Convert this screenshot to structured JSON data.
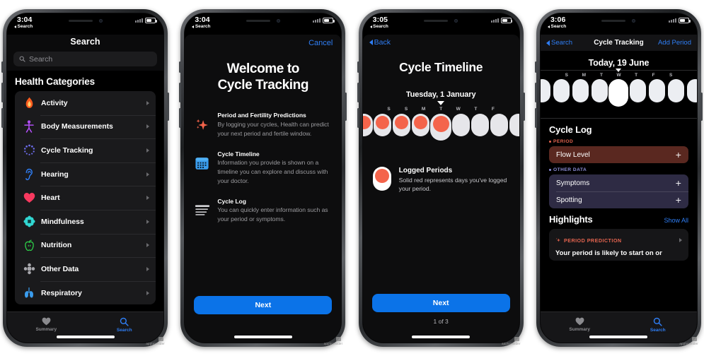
{
  "phones": [
    {
      "id": "phone-search",
      "status": {
        "time": "3:04",
        "back_label": "Search",
        "battery_icon": "battery-icon",
        "signal_icon": "signal-icon"
      },
      "screen": {
        "title": "Search",
        "search": {
          "placeholder": "Search",
          "value": "",
          "icon": "search-icon"
        },
        "section_label": "Health Categories",
        "categories": [
          {
            "label": "Activity",
            "icon": "flame-icon",
            "color": "#fb5b1e"
          },
          {
            "label": "Body Measurements",
            "icon": "body-icon",
            "color": "#b14ef5"
          },
          {
            "label": "Cycle Tracking",
            "icon": "cycle-icon",
            "color": "#6e6ef0"
          },
          {
            "label": "Hearing",
            "icon": "ear-icon",
            "color": "#2f7ef5"
          },
          {
            "label": "Heart",
            "icon": "heart-icon",
            "color": "#f8395f"
          },
          {
            "label": "Mindfulness",
            "icon": "mindfulness-icon",
            "color": "#31d7d2"
          },
          {
            "label": "Nutrition",
            "icon": "apple-icon",
            "color": "#2ed44a"
          },
          {
            "label": "Other Data",
            "icon": "other-data-icon",
            "color": "#a8a8ad"
          },
          {
            "label": "Respiratory",
            "icon": "lungs-icon",
            "color": "#3a9ced"
          }
        ],
        "tabs": [
          {
            "label": "Summary",
            "icon": "heart-filled-icon",
            "active": false
          },
          {
            "label": "Search",
            "icon": "search-icon",
            "active": true
          }
        ]
      }
    },
    {
      "id": "phone-welcome",
      "status": {
        "time": "3:04",
        "back_label": "Search"
      },
      "screen": {
        "cancel_label": "Cancel",
        "title_line1": "Welcome to",
        "title_line2": "Cycle Tracking",
        "features": [
          {
            "icon": "sparkle-icon",
            "heading": "Period and Fertility Predictions",
            "body": "By logging your cycles, Health can predict your next period and fertile window."
          },
          {
            "icon": "calendar-icon",
            "heading": "Cycle Timeline",
            "body": "Information you provide is shown on a timeline you can explore and discuss with your doctor."
          },
          {
            "icon": "list-lines-icon",
            "heading": "Cycle Log",
            "body": "You can quickly enter information such as your period or symptoms."
          }
        ],
        "next_label": "Next"
      }
    },
    {
      "id": "phone-timeline",
      "status": {
        "time": "3:05",
        "back_label": "Search"
      },
      "screen": {
        "back_label": "Back",
        "title": "Cycle Timeline",
        "date": "Tuesday, 1 January",
        "day_letters": [
          "S",
          "S",
          "M",
          "T",
          "W",
          "T",
          "F"
        ],
        "days": [
          {
            "letter": "",
            "logged": true,
            "selected": false,
            "partial": true
          },
          {
            "letter": "S",
            "logged": true,
            "selected": false
          },
          {
            "letter": "S",
            "logged": true,
            "selected": false
          },
          {
            "letter": "M",
            "logged": true,
            "selected": false
          },
          {
            "letter": "T",
            "logged": true,
            "selected": true
          },
          {
            "letter": "W",
            "logged": false,
            "selected": false
          },
          {
            "letter": "T",
            "logged": false,
            "selected": false
          },
          {
            "letter": "F",
            "logged": false,
            "selected": false
          },
          {
            "letter": "",
            "logged": false,
            "selected": false,
            "partial": true
          }
        ],
        "legend": {
          "heading": "Logged Periods",
          "body": "Solid red represents days you've logged your period."
        },
        "next_label": "Next",
        "page_indicator": "1 of 3"
      }
    },
    {
      "id": "phone-cycle-tracking",
      "status": {
        "time": "3:06",
        "back_label": "Search"
      },
      "screen": {
        "nav": {
          "back_label": "Search",
          "title": "Cycle Tracking",
          "action_label": "Add Period"
        },
        "today_label": "Today, 19 June",
        "day_letters": [
          "S",
          "M",
          "T",
          "W",
          "T",
          "F",
          "S"
        ],
        "days": [
          {
            "letter": "",
            "selected": false,
            "partial": true
          },
          {
            "letter": "S",
            "selected": false
          },
          {
            "letter": "M",
            "selected": false
          },
          {
            "letter": "T",
            "selected": false
          },
          {
            "letter": "W",
            "selected": true
          },
          {
            "letter": "T",
            "selected": false
          },
          {
            "letter": "F",
            "selected": false
          },
          {
            "letter": "S",
            "selected": false
          },
          {
            "letter": "",
            "selected": false,
            "partial": true
          }
        ],
        "cycle_log": {
          "heading": "Cycle Log",
          "groups": [
            {
              "label": "PERIOD",
              "color": "#e4644f",
              "card_bg": "#5a2820",
              "items": [
                {
                  "label": "Flow Level",
                  "action": "+"
                }
              ]
            },
            {
              "label": "OTHER DATA",
              "color": "#8e8ed8",
              "card_bg": "#2e2b44",
              "items": [
                {
                  "label": "Symptoms",
                  "action": "+"
                },
                {
                  "label": "Spotting",
                  "action": "+"
                }
              ]
            }
          ]
        },
        "highlights": {
          "heading": "Highlights",
          "show_all_label": "Show All",
          "card": {
            "tag": "PERIOD PREDICTION",
            "tag_icon": "sparkle-icon",
            "body": "Your period is likely to start on or"
          }
        },
        "tabs": [
          {
            "label": "Summary",
            "icon": "heart-filled-icon",
            "active": false
          },
          {
            "label": "Search",
            "icon": "search-icon",
            "active": true
          }
        ]
      }
    }
  ],
  "watermark": "appleinsider"
}
